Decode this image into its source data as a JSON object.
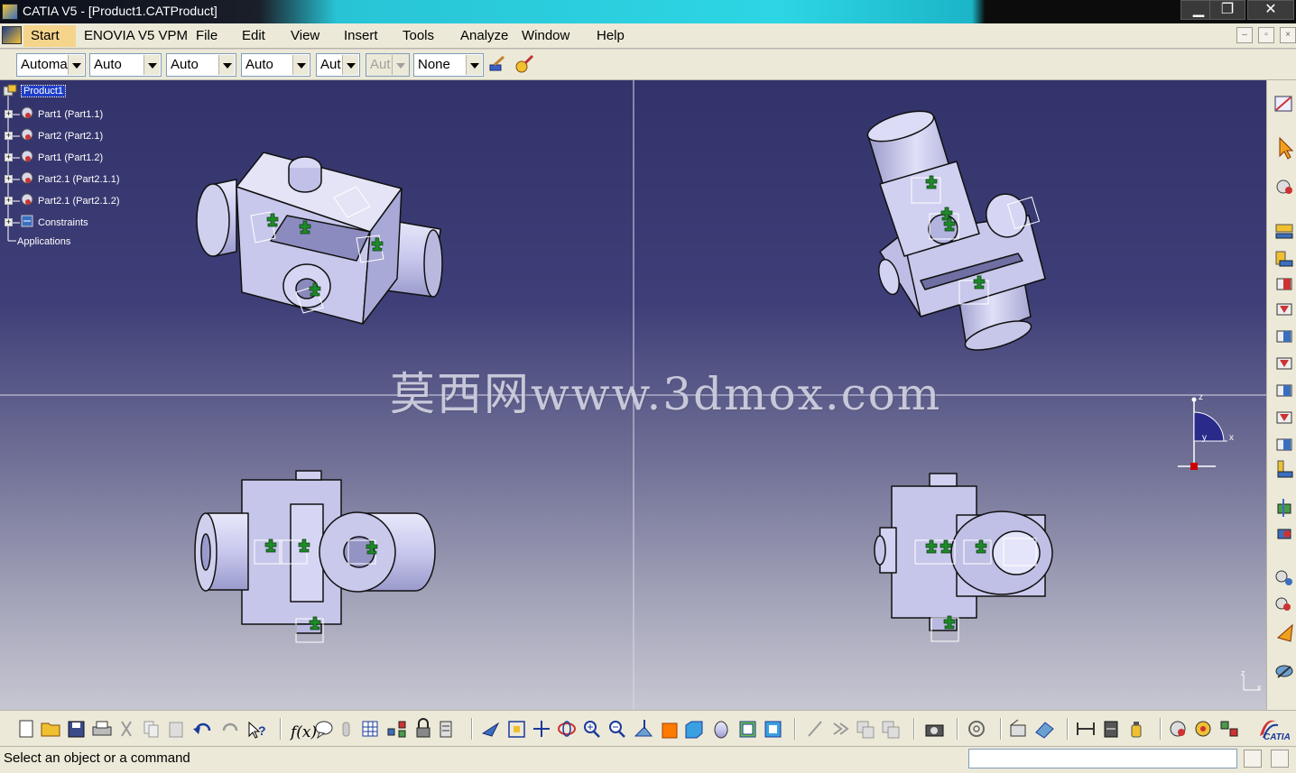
{
  "window": {
    "title": "CATIA V5 - [Product1.CATProduct]",
    "controls": {
      "minimize": "▁",
      "restore": "❐",
      "close": "✕"
    }
  },
  "menu": {
    "items": [
      "Start",
      "ENOVIA V5 VPM",
      "File",
      "Edit",
      "View",
      "Insert",
      "Tools",
      "Analyze",
      "Window",
      "Help"
    ]
  },
  "toolbar": {
    "combos": [
      {
        "value": "Automa",
        "enabled": true
      },
      {
        "value": "Auto",
        "enabled": true
      },
      {
        "value": "Auto",
        "enabled": true
      },
      {
        "value": "Auto",
        "enabled": true
      },
      {
        "value": "Aut",
        "enabled": true
      },
      {
        "value": "Aut",
        "enabled": false
      },
      {
        "value": "None",
        "enabled": true
      }
    ],
    "icons": [
      "painter-icon",
      "paint-bucket-icon"
    ]
  },
  "tree": {
    "root": "Product1",
    "children": [
      {
        "label": "Part1 (Part1.1)"
      },
      {
        "label": "Part2 (Part2.1)"
      },
      {
        "label": "Part1 (Part1.2)"
      },
      {
        "label": "Part2.1 (Part2.1.1)"
      },
      {
        "label": "Part2.1 (Part2.1.2)"
      },
      {
        "label": "Constraints"
      },
      {
        "label": "Applications"
      }
    ]
  },
  "watermark": "莫西网www.3dmox.com",
  "compass": {
    "x": "x",
    "y": "y",
    "z": "z"
  },
  "status": {
    "text": "Select an object or a command"
  },
  "brand": "CATIA",
  "colors": {
    "viewport_top": "#33336b",
    "viewport_bottom": "#c7c7d2",
    "part_fill": "#c9c9ea",
    "constraint_green": "#1f8a2a",
    "selection": "#1e3ec9",
    "compass_red": "#cc0000"
  }
}
